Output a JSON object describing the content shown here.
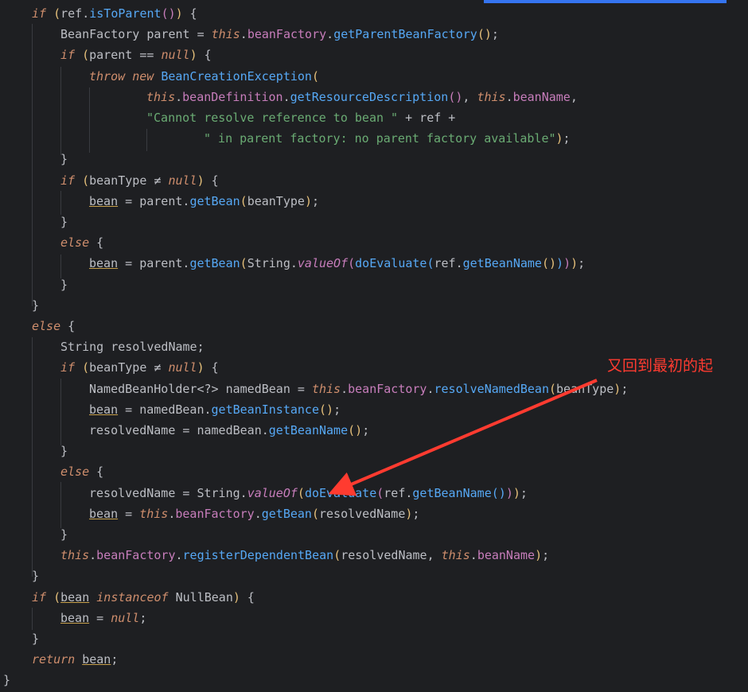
{
  "editor": {
    "lines": [
      [
        [
          "kw",
          "if"
        ],
        [
          "pl",
          " "
        ],
        [
          "br0",
          "("
        ],
        [
          "var",
          "ref"
        ],
        [
          "pl",
          "."
        ],
        [
          "m",
          "isToParent"
        ],
        [
          "br1",
          "()"
        ],
        [
          "br0",
          ")"
        ],
        [
          "pl",
          " {"
        ]
      ],
      [
        [
          "cls",
          "BeanFactory"
        ],
        [
          "pl",
          " "
        ],
        [
          "var",
          "parent"
        ],
        [
          "pl",
          " = "
        ],
        [
          "kw",
          "this"
        ],
        [
          "pl",
          "."
        ],
        [
          "fld",
          "beanFactory"
        ],
        [
          "pl",
          "."
        ],
        [
          "m",
          "getParentBeanFactory"
        ],
        [
          "br0",
          "()"
        ],
        [
          "pl",
          ";"
        ]
      ],
      [
        [
          "kw",
          "if"
        ],
        [
          "pl",
          " "
        ],
        [
          "br0",
          "("
        ],
        [
          "var",
          "parent"
        ],
        [
          "pl",
          " == "
        ],
        [
          "kw",
          "null"
        ],
        [
          "br0",
          ")"
        ],
        [
          "pl",
          " {"
        ]
      ],
      [
        [
          "kw",
          "throw"
        ],
        [
          "pl",
          " "
        ],
        [
          "kw",
          "new"
        ],
        [
          "pl",
          " "
        ],
        [
          "m",
          "BeanCreationException"
        ],
        [
          "br0",
          "("
        ]
      ],
      [
        [
          "kw",
          "this"
        ],
        [
          "pl",
          "."
        ],
        [
          "fld",
          "beanDefinition"
        ],
        [
          "pl",
          "."
        ],
        [
          "m",
          "getResourceDescription"
        ],
        [
          "br1",
          "()"
        ],
        [
          "pl",
          ", "
        ],
        [
          "kw",
          "this"
        ],
        [
          "pl",
          "."
        ],
        [
          "fld",
          "beanName"
        ],
        [
          "pl",
          ","
        ]
      ],
      [
        [
          "str",
          "\"Cannot resolve reference to bean \""
        ],
        [
          "pl",
          " + "
        ],
        [
          "var",
          "ref"
        ],
        [
          "pl",
          " +"
        ]
      ],
      [
        [
          "str",
          "\" in parent factory: no parent factory available\""
        ],
        [
          "br0",
          ")"
        ],
        [
          "pl",
          ";"
        ]
      ],
      [
        [
          "pl",
          "}"
        ]
      ],
      [
        [
          "kw",
          "if"
        ],
        [
          "pl",
          " "
        ],
        [
          "br0",
          "("
        ],
        [
          "var",
          "beanType"
        ],
        [
          "pl",
          " ≠ "
        ],
        [
          "kw",
          "null"
        ],
        [
          "br0",
          ")"
        ],
        [
          "pl",
          " {"
        ]
      ],
      [
        [
          "ul",
          "bean"
        ],
        [
          "pl",
          " = "
        ],
        [
          "var",
          "parent"
        ],
        [
          "pl",
          "."
        ],
        [
          "m",
          "getBean"
        ],
        [
          "br0",
          "("
        ],
        [
          "var",
          "beanType"
        ],
        [
          "br0",
          ")"
        ],
        [
          "pl",
          ";"
        ]
      ],
      [
        [
          "pl",
          "}"
        ]
      ],
      [
        [
          "kw",
          "else"
        ],
        [
          "pl",
          " {"
        ]
      ],
      [
        [
          "ul",
          "bean"
        ],
        [
          "pl",
          " = "
        ],
        [
          "var",
          "parent"
        ],
        [
          "pl",
          "."
        ],
        [
          "m",
          "getBean"
        ],
        [
          "br0",
          "("
        ],
        [
          "cls",
          "String"
        ],
        [
          "pl",
          "."
        ],
        [
          "st",
          "valueOf"
        ],
        [
          "br1",
          "("
        ],
        [
          "m",
          "doEvaluate"
        ],
        [
          "br2",
          "("
        ],
        [
          "var",
          "ref"
        ],
        [
          "pl",
          "."
        ],
        [
          "m",
          "getBeanName"
        ],
        [
          "br0",
          "()"
        ],
        [
          "br2",
          ")"
        ],
        [
          "br1",
          ")"
        ],
        [
          "br0",
          ")"
        ],
        [
          "pl",
          ";"
        ]
      ],
      [
        [
          "pl",
          "}"
        ]
      ],
      [
        [
          "pl",
          "}"
        ]
      ],
      [
        [
          "kw",
          "else"
        ],
        [
          "pl",
          " {"
        ]
      ],
      [
        [
          "cls",
          "String"
        ],
        [
          "pl",
          " "
        ],
        [
          "var",
          "resolvedName"
        ],
        [
          "pl",
          ";"
        ]
      ],
      [
        [
          "kw",
          "if"
        ],
        [
          "pl",
          " "
        ],
        [
          "br0",
          "("
        ],
        [
          "var",
          "beanType"
        ],
        [
          "pl",
          " ≠ "
        ],
        [
          "kw",
          "null"
        ],
        [
          "br0",
          ")"
        ],
        [
          "pl",
          " {"
        ]
      ],
      [
        [
          "cls",
          "NamedBeanHolder"
        ],
        [
          "pl",
          "<?> "
        ],
        [
          "var",
          "namedBean"
        ],
        [
          "pl",
          " = "
        ],
        [
          "kw",
          "this"
        ],
        [
          "pl",
          "."
        ],
        [
          "fld",
          "beanFactory"
        ],
        [
          "pl",
          "."
        ],
        [
          "m",
          "resolveNamedBean"
        ],
        [
          "br0",
          "("
        ],
        [
          "var",
          "beanType"
        ],
        [
          "br0",
          ")"
        ],
        [
          "pl",
          ";"
        ]
      ],
      [
        [
          "ul",
          "bean"
        ],
        [
          "pl",
          " = "
        ],
        [
          "var",
          "namedBean"
        ],
        [
          "pl",
          "."
        ],
        [
          "m",
          "getBeanInstance"
        ],
        [
          "br0",
          "()"
        ],
        [
          "pl",
          ";"
        ]
      ],
      [
        [
          "var",
          "resolvedName"
        ],
        [
          "pl",
          " = "
        ],
        [
          "var",
          "namedBean"
        ],
        [
          "pl",
          "."
        ],
        [
          "m",
          "getBeanName"
        ],
        [
          "br0",
          "()"
        ],
        [
          "pl",
          ";"
        ]
      ],
      [
        [
          "pl",
          "}"
        ]
      ],
      [
        [
          "kw",
          "else"
        ],
        [
          "pl",
          " {"
        ]
      ],
      [
        [
          "var",
          "resolvedName"
        ],
        [
          "pl",
          " = "
        ],
        [
          "cls",
          "String"
        ],
        [
          "pl",
          "."
        ],
        [
          "st",
          "valueOf"
        ],
        [
          "br0",
          "("
        ],
        [
          "m",
          "doEvaluate"
        ],
        [
          "br1",
          "("
        ],
        [
          "var",
          "ref"
        ],
        [
          "pl",
          "."
        ],
        [
          "m",
          "getBeanName"
        ],
        [
          "br2",
          "()"
        ],
        [
          "br1",
          ")"
        ],
        [
          "br0",
          ")"
        ],
        [
          "pl",
          ";"
        ]
      ],
      [
        [
          "ul",
          "bean"
        ],
        [
          "pl",
          " = "
        ],
        [
          "kw",
          "this"
        ],
        [
          "pl",
          "."
        ],
        [
          "fld",
          "beanFactory"
        ],
        [
          "pl",
          "."
        ],
        [
          "m",
          "getBean"
        ],
        [
          "br0",
          "("
        ],
        [
          "var",
          "resolvedName"
        ],
        [
          "br0",
          ")"
        ],
        [
          "pl",
          ";"
        ]
      ],
      [
        [
          "pl",
          "}"
        ]
      ],
      [
        [
          "kw",
          "this"
        ],
        [
          "pl",
          "."
        ],
        [
          "fld",
          "beanFactory"
        ],
        [
          "pl",
          "."
        ],
        [
          "m",
          "registerDependentBean"
        ],
        [
          "br0",
          "("
        ],
        [
          "var",
          "resolvedName"
        ],
        [
          "pl",
          ", "
        ],
        [
          "kw",
          "this"
        ],
        [
          "pl",
          "."
        ],
        [
          "fld",
          "beanName"
        ],
        [
          "br0",
          ")"
        ],
        [
          "pl",
          ";"
        ]
      ],
      [
        [
          "pl",
          "}"
        ]
      ],
      [
        [
          "kw",
          "if"
        ],
        [
          "pl",
          " "
        ],
        [
          "br0",
          "("
        ],
        [
          "ul",
          "bean"
        ],
        [
          "pl",
          " "
        ],
        [
          "kw",
          "instanceof"
        ],
        [
          "pl",
          " "
        ],
        [
          "cls",
          "NullBean"
        ],
        [
          "br0",
          ")"
        ],
        [
          "pl",
          " {"
        ]
      ],
      [
        [
          "ul",
          "bean"
        ],
        [
          "pl",
          " = "
        ],
        [
          "kw",
          "null"
        ],
        [
          "pl",
          ";"
        ]
      ],
      [
        [
          "pl",
          "}"
        ]
      ],
      [
        [
          "kw",
          "return"
        ],
        [
          "pl",
          " "
        ],
        [
          "ul",
          "bean"
        ],
        [
          "pl",
          ";"
        ]
      ],
      [
        [
          "pl",
          "}"
        ]
      ]
    ]
  },
  "annotation": {
    "text": "又回到最初的起"
  },
  "colors": {
    "background": "#1e1f22",
    "keyword": "#cf8e6d",
    "method": "#56a8f5",
    "field": "#c77dbb",
    "string": "#6aab73",
    "plain": "#bcbec4",
    "annotation": "#ff3b30",
    "active_tab": "#3574f0"
  }
}
